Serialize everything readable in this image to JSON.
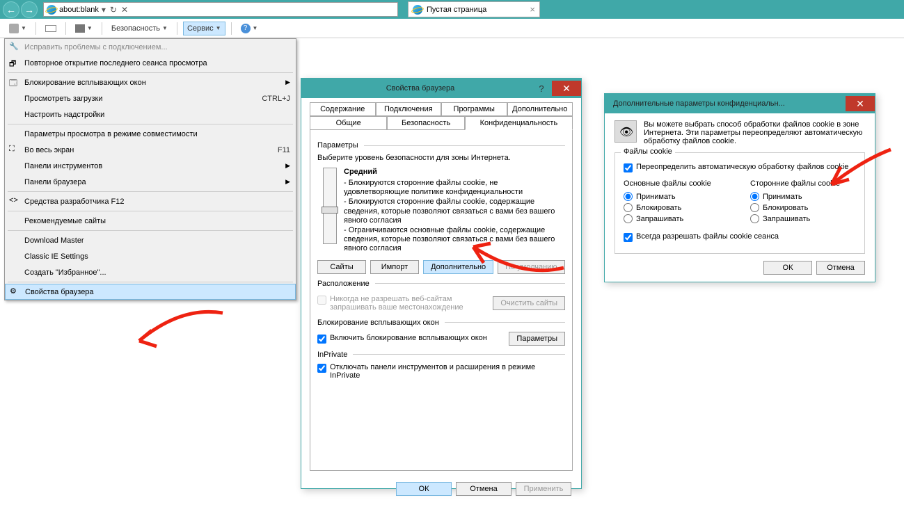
{
  "nav": {
    "url": "about:blank",
    "tab_title": "Пустая страница"
  },
  "toolbar": {
    "security": "Безопасность",
    "service": "Сервис"
  },
  "menu": {
    "fix_conn": "Исправить проблемы с подключением...",
    "reopen": "Повторное открытие последнего сеанса просмотра",
    "popup": "Блокирование всплывающих окон",
    "downloads": "Просмотреть загрузки",
    "downloads_sc": "CTRL+J",
    "addons": "Настроить надстройки",
    "compat": "Параметры просмотра в режиме совместимости",
    "fullscreen": "Во весь экран",
    "fullscreen_sc": "F11",
    "toolpanels": "Панели инструментов",
    "browserpanels": "Панели браузера",
    "devtools": "Средства разработчика F12",
    "recommended": "Рекомендуемые сайты",
    "dm": "Download Master",
    "classic": "Classic IE Settings",
    "favorites": "Создать \"Избранное\"...",
    "props": "Свойства браузера"
  },
  "dlg1": {
    "title": "Свойства браузера",
    "tabs": {
      "content": "Содержание",
      "connections": "Подключения",
      "programs": "Программы",
      "advanced": "Дополнительно",
      "general": "Общие",
      "security": "Безопасность",
      "privacy": "Конфиденциальность"
    },
    "params": "Параметры",
    "select_level": "Выберите уровень безопасности для зоны Интернета.",
    "level": "Средний",
    "d1": "- Блокируются сторонние файлы cookie, не удовлетворяющие политике конфиденциальности",
    "d2": "- Блокируются сторонние файлы cookie, содержащие сведения, которые позволяют связаться с вами без вашего явного согласия",
    "d3": "- Ограничиваются основные файлы cookie, содержащие сведения, которые позволяют связаться с вами без вашего явного согласия",
    "btn_sites": "Сайты",
    "btn_import": "Импорт",
    "btn_advanced": "Дополнительно",
    "btn_default": "По умолчанию",
    "location": "Расположение",
    "never_allow": "Никогда не разрешать веб-сайтам запрашивать ваше местонахождение",
    "clear_sites": "Очистить сайты",
    "popup_block": "Блокирование всплывающих окон",
    "enable_popup": "Включить блокирование всплывающих окон",
    "btn_params": "Параметры",
    "inprivate": "InPrivate",
    "disable_toolbars": "Отключать панели инструментов и расширения в режиме InPrivate",
    "ok": "ОК",
    "cancel": "Отмена",
    "apply": "Применить"
  },
  "dlg2": {
    "title": "Дополнительные параметры конфиденциальн...",
    "info": "Вы можете выбрать способ обработки файлов cookie в зоне Интернета. Эти параметры переопределяют автоматическую обработку файлов cookie.",
    "group": "Файлы cookie",
    "override": "Переопределить автоматическую обработку файлов cookie",
    "col1": "Основные файлы cookie",
    "col2": "Сторонние файлы cookie",
    "r_accept": "Принимать",
    "r_block": "Блокировать",
    "r_prompt": "Запрашивать",
    "session": "Всегда разрешать файлы cookie сеанса",
    "ok": "ОК",
    "cancel": "Отмена"
  }
}
